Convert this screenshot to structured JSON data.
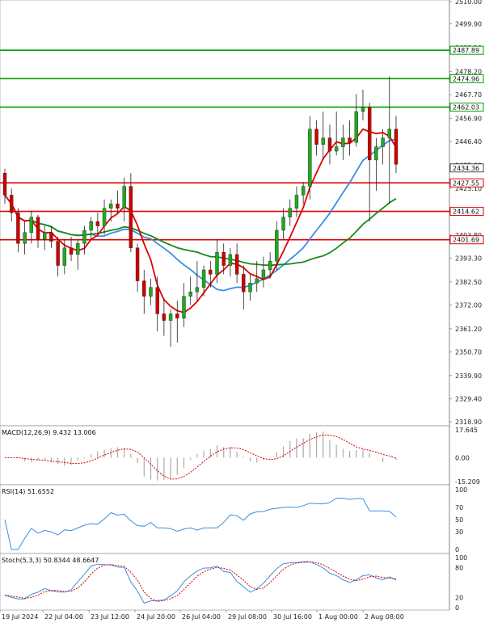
{
  "chart_data": {
    "type": "candlestick",
    "symbol_note": "",
    "y_axis_ticks": [
      "2510.00",
      "2499.90",
      "2489.10",
      "2478.20",
      "2467.70",
      "2456.90",
      "2446.40",
      "2435.60",
      "2425.10",
      "2414.20",
      "2403.80",
      "2393.30",
      "2382.50",
      "2372.00",
      "2361.20",
      "2350.70",
      "2339.90",
      "2329.40",
      "2318.90"
    ],
    "ylim": [
      2318.9,
      2510.0
    ],
    "x_axis_ticks": [
      "19 Jul 2024",
      "22 Jul 04:00",
      "23 Jul 12:00",
      "24 Jul 20:00",
      "26 Jul 04:00",
      "29 Jul 08:00",
      "30 Jul 16:00",
      "1 Aug 00:00",
      "2 Aug 08:00"
    ],
    "horizontal_levels": [
      {
        "label": "2487.89",
        "value": 2487.89,
        "color": "#00a000"
      },
      {
        "label": "2474.96",
        "value": 2474.96,
        "color": "#00a000"
      },
      {
        "label": "2462.03",
        "value": 2462.03,
        "color": "#00a000"
      },
      {
        "label": "2427.55",
        "value": 2427.55,
        "color": "#e00000"
      },
      {
        "label": "2414.62",
        "value": 2414.62,
        "color": "#e00000"
      },
      {
        "label": "2401.69",
        "value": 2401.69,
        "color": "#e00000"
      }
    ],
    "current_price": {
      "label": "2434.36",
      "value": 2434.36
    },
    "candles": [
      [
        2432,
        2434,
        2418,
        2422
      ],
      [
        2422,
        2425,
        2410,
        2414
      ],
      [
        2414,
        2416,
        2396,
        2400
      ],
      [
        2400,
        2410,
        2395,
        2405
      ],
      [
        2405,
        2415,
        2400,
        2412
      ],
      [
        2412,
        2413,
        2398,
        2402
      ],
      [
        2402,
        2408,
        2397,
        2405
      ],
      [
        2405,
        2408,
        2398,
        2401
      ],
      [
        2401,
        2403,
        2385,
        2390
      ],
      [
        2390,
        2402,
        2386,
        2398
      ],
      [
        2398,
        2403,
        2392,
        2395
      ],
      [
        2395,
        2402,
        2388,
        2400
      ],
      [
        2400,
        2408,
        2395,
        2406
      ],
      [
        2406,
        2412,
        2402,
        2410
      ],
      [
        2410,
        2414,
        2404,
        2408
      ],
      [
        2408,
        2420,
        2404,
        2416
      ],
      [
        2416,
        2420,
        2410,
        2418
      ],
      [
        2418,
        2424,
        2414,
        2416
      ],
      [
        2416,
        2430,
        2410,
        2426
      ],
      [
        2426,
        2432,
        2396,
        2398
      ],
      [
        2398,
        2400,
        2378,
        2383
      ],
      [
        2383,
        2388,
        2368,
        2376
      ],
      [
        2376,
        2384,
        2372,
        2380
      ],
      [
        2380,
        2385,
        2360,
        2368
      ],
      [
        2368,
        2375,
        2358,
        2365
      ],
      [
        2365,
        2370,
        2353,
        2368
      ],
      [
        2368,
        2374,
        2355,
        2366
      ],
      [
        2366,
        2382,
        2362,
        2376
      ],
      [
        2376,
        2385,
        2372,
        2378
      ],
      [
        2378,
        2392,
        2374,
        2380
      ],
      [
        2380,
        2390,
        2376,
        2388
      ],
      [
        2388,
        2392,
        2380,
        2386
      ],
      [
        2386,
        2402,
        2382,
        2396
      ],
      [
        2396,
        2400,
        2386,
        2390
      ],
      [
        2390,
        2398,
        2385,
        2395
      ],
      [
        2395,
        2400,
        2382,
        2386
      ],
      [
        2386,
        2390,
        2370,
        2378
      ],
      [
        2378,
        2386,
        2374,
        2382
      ],
      [
        2382,
        2392,
        2378,
        2384
      ],
      [
        2384,
        2394,
        2380,
        2388
      ],
      [
        2388,
        2396,
        2384,
        2392
      ],
      [
        2392,
        2410,
        2388,
        2406
      ],
      [
        2406,
        2416,
        2402,
        2412
      ],
      [
        2412,
        2420,
        2408,
        2416
      ],
      [
        2416,
        2426,
        2412,
        2422
      ],
      [
        2422,
        2428,
        2418,
        2426
      ],
      [
        2426,
        2458,
        2420,
        2452
      ],
      [
        2452,
        2456,
        2440,
        2445
      ],
      [
        2445,
        2460,
        2438,
        2448
      ],
      [
        2448,
        2454,
        2436,
        2442
      ],
      [
        2442,
        2460,
        2440,
        2444
      ],
      [
        2444,
        2454,
        2438,
        2448
      ],
      [
        2448,
        2456,
        2440,
        2446
      ],
      [
        2446,
        2468,
        2444,
        2460
      ],
      [
        2460,
        2470,
        2456,
        2462
      ],
      [
        2462,
        2464,
        2410,
        2438
      ],
      [
        2438,
        2448,
        2424,
        2444
      ],
      [
        2444,
        2452,
        2436,
        2448
      ],
      [
        2448,
        2476,
        2418,
        2452
      ],
      [
        2452,
        2458,
        2432,
        2436
      ]
    ],
    "ma_fast_color": "#e00000",
    "ma_mid_color": "#3a8fe0",
    "ma_slow_color": "#1a8a1a",
    "macd": {
      "label": "MACD(12,26,9) 9.432 13.006",
      "ticks": [
        "17.645",
        "0.00",
        "-15.209"
      ],
      "range": [
        -15.209,
        17.645
      ]
    },
    "rsi": {
      "label": "RSI(14) 51.6552",
      "ticks": [
        "100",
        "70",
        "50",
        "30",
        "0"
      ],
      "range": [
        0,
        100
      ]
    },
    "stoch": {
      "label": "Stoch(5,3,3) 50.8344 48.6647",
      "ticks": [
        "100",
        "80",
        "20",
        "0"
      ],
      "range": [
        0,
        100
      ]
    }
  }
}
